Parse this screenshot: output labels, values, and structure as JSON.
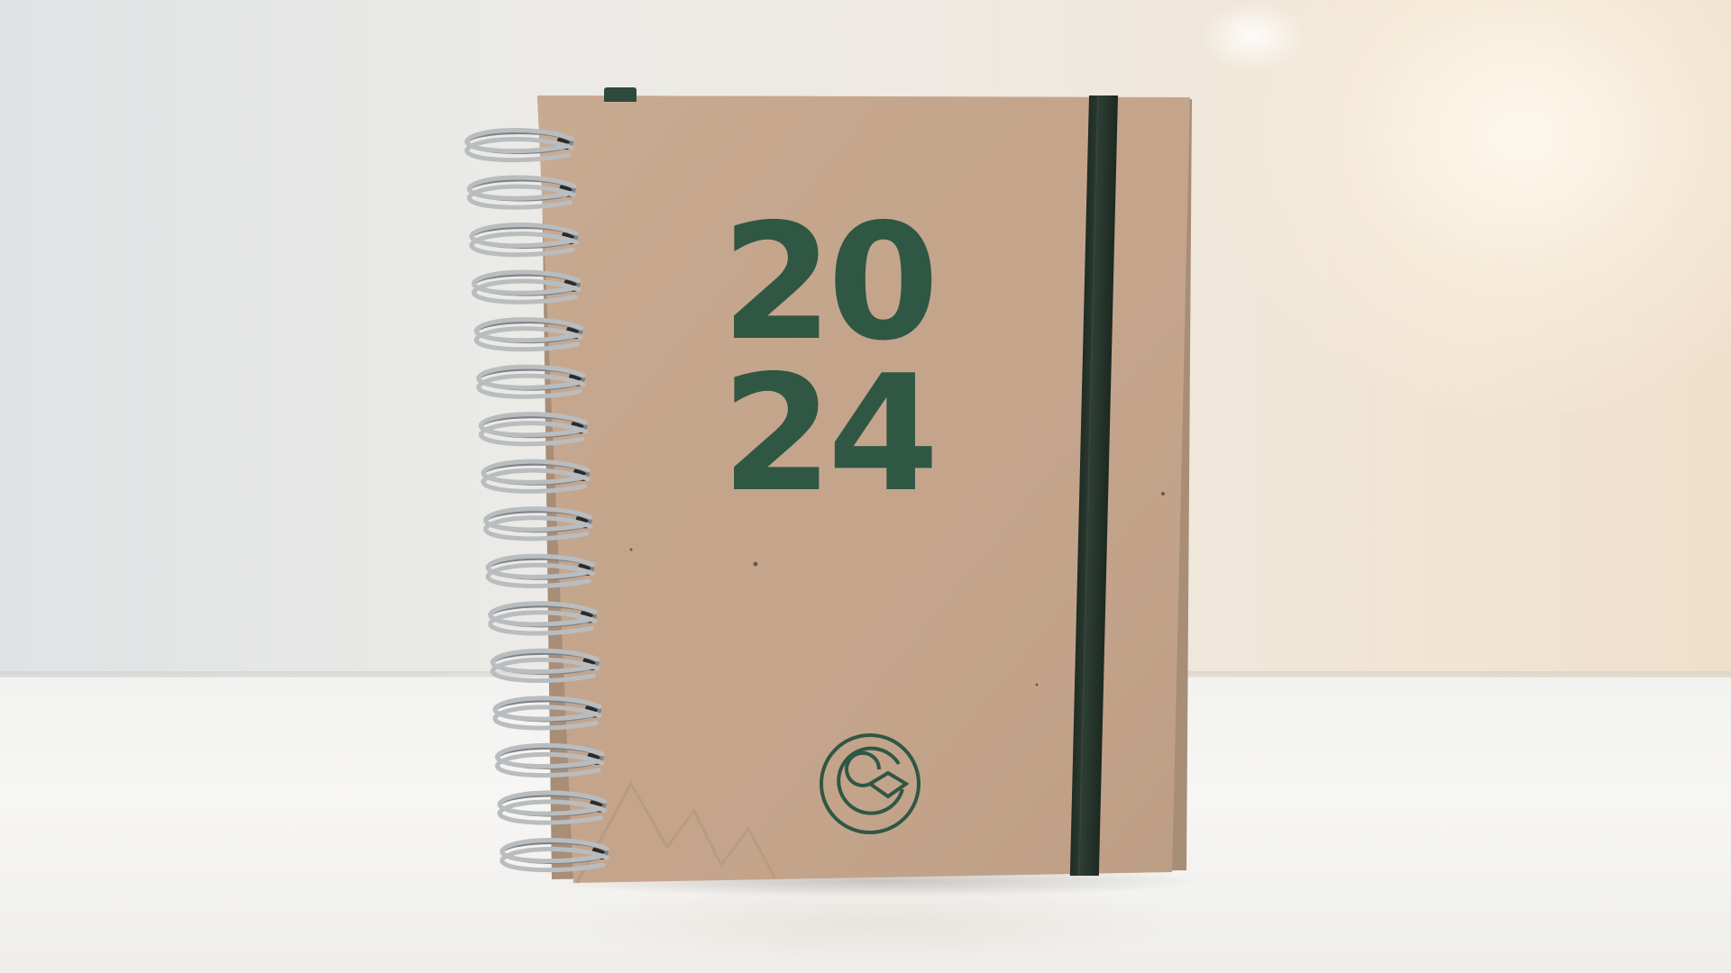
{
  "scene": {
    "subject": "spiral planner",
    "colors": {
      "wall": "#ebeae7",
      "table": "#f4f3f1",
      "cover": "#c4a58c",
      "print": "#2f5744",
      "strap": "#24332b",
      "ring": "#b9bdc0"
    }
  },
  "cover": {
    "year_top": "20",
    "year_bottom": "24",
    "logo_icon": "g-logo-icon"
  },
  "binding": {
    "ring_count": 16
  }
}
